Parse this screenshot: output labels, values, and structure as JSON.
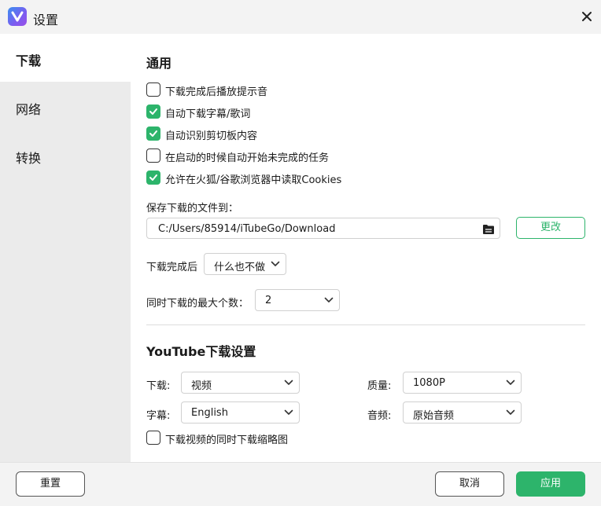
{
  "window": {
    "title": "设置",
    "icons": {
      "app": "app-logo-icon",
      "close": "close-icon"
    }
  },
  "sidebar": {
    "items": [
      {
        "label": "下载",
        "active": true
      },
      {
        "label": "网络",
        "active": false
      },
      {
        "label": "转换",
        "active": false
      }
    ]
  },
  "general": {
    "title": "通用",
    "options": [
      {
        "label": "下载完成后播放提示音",
        "checked": false
      },
      {
        "label": "自动下载字幕/歌词",
        "checked": true
      },
      {
        "label": "自动识别剪切板内容",
        "checked": true
      },
      {
        "label": "在启动的时候自动开始未完成的任务",
        "checked": false
      },
      {
        "label": "允许在火狐/谷歌浏览器中读取Cookies",
        "checked": true
      }
    ],
    "save_label": "保存下载的文件到：",
    "save_path": "C:/Users/85914/iTubeGo/Download",
    "change_button": "更改",
    "after_label": "下载完成后",
    "after_value": "什么也不做",
    "max_label": "同时下载的最大个数：",
    "max_value": "2"
  },
  "youtube": {
    "title": "YouTube下载设置",
    "download_label": "下载:",
    "download_value": "视频",
    "quality_label": "质量:",
    "quality_value": "1080P",
    "subtitle_label": "字幕:",
    "subtitle_value": "English",
    "audio_label": "音频:",
    "audio_value": "原始音频",
    "thumbnail_label": "下载视频的同时下载缩略图",
    "thumbnail_checked": false
  },
  "footer": {
    "reset": "重置",
    "cancel": "取消",
    "apply": "应用"
  },
  "colors": {
    "accent": "#2db46b",
    "sidebar_bg": "#ebebeb",
    "titlebar_bg": "#f3f3f3"
  }
}
